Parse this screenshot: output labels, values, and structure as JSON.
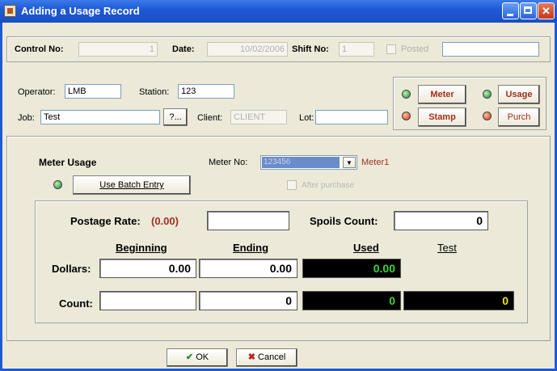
{
  "window": {
    "title": "Adding a Usage Record"
  },
  "header": {
    "control_no_label": "Control No:",
    "control_no_value": "1",
    "date_label": "Date:",
    "date_value": "10/02/2006",
    "shift_no_label": "Shift No:",
    "shift_no_value": "1",
    "posted_label": "Posted",
    "posted_value": ""
  },
  "info": {
    "operator_label": "Operator:",
    "operator_value": "LMB",
    "station_label": "Station:",
    "station_value": "123",
    "job_label": "Job:",
    "job_value": "Test",
    "job_lookup_label": "?...",
    "client_label": "Client:",
    "client_value": "CLIENT",
    "lot_label": "Lot:",
    "lot_value": ""
  },
  "mode_buttons": {
    "meter": "Meter",
    "stamp": "Stamp",
    "usage": "Usage",
    "purch": "Purch"
  },
  "meter": {
    "section_title": "Meter Usage",
    "meter_no_label": "Meter No:",
    "meter_no_value": "123456",
    "meter_name": "Meter1",
    "batch_button": "Use Batch Entry",
    "after_purchase_label": "After purchase"
  },
  "rates": {
    "postage_rate_label": "Postage Rate:",
    "postage_rate_value": "(0.00)",
    "postage_rate_input": "",
    "spoils_label": "Spoils Count:",
    "spoils_value": "0"
  },
  "grid": {
    "col_beginning": "Beginning",
    "col_ending": "Ending",
    "col_used": "Used",
    "col_test": "Test",
    "dollars_label": "Dollars:",
    "count_label": "Count:",
    "dollars_beginning": "0.00",
    "dollars_ending": "0.00",
    "dollars_used": "0.00",
    "count_beginning": "",
    "count_ending": "0",
    "count_used": "0",
    "count_test": "0"
  },
  "footer": {
    "ok": "OK",
    "cancel": "Cancel"
  },
  "colors": {
    "title_bar": "#1f5ad6",
    "dark_red_text": "#a03020",
    "used_green": "#3ad43a",
    "test_yellow": "#e8e020"
  }
}
